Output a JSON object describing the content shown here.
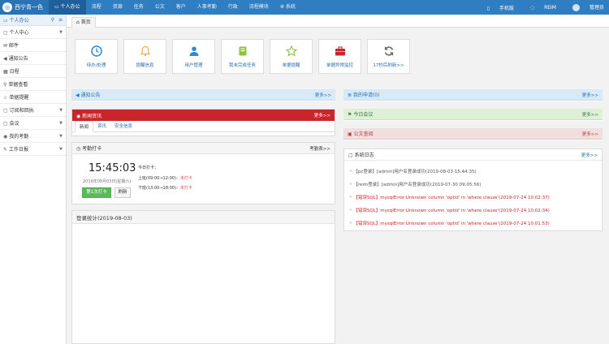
{
  "header": {
    "logo_mark": "◎",
    "logo_text": "西宁青一色",
    "nav": [
      {
        "label": "个人办公",
        "icon": "monitor-icon",
        "glyph": "▭",
        "active": true
      },
      {
        "label": "流程",
        "active": false
      },
      {
        "label": "资源",
        "active": false
      },
      {
        "label": "任务",
        "active": false
      },
      {
        "label": "公文",
        "active": false
      },
      {
        "label": "客户",
        "active": false
      },
      {
        "label": "人事考勤",
        "active": false
      },
      {
        "label": "行政",
        "active": false
      },
      {
        "label": "流程模块",
        "active": false
      },
      {
        "label": "系统",
        "icon": "gear-icon",
        "glyph": "✲",
        "active": false
      }
    ],
    "right": {
      "mobile": "手机版",
      "im": "REIM",
      "user": "管理员"
    }
  },
  "sidebar": {
    "title": "个人办公",
    "items": [
      {
        "label": "个人中心",
        "glyph": "▢",
        "expandable": true
      },
      {
        "label": "邮件",
        "glyph": "✉",
        "expandable": false
      },
      {
        "label": "通知公告",
        "glyph": "◀",
        "expandable": false
      },
      {
        "label": "日程",
        "glyph": "▦",
        "expandable": false
      },
      {
        "label": "单据查看",
        "glyph": "⚲",
        "expandable": false
      },
      {
        "label": "单据提醒",
        "glyph": "☆",
        "expandable": false
      },
      {
        "label": "订阅和回执",
        "glyph": "▢",
        "expandable": true
      },
      {
        "label": "会议",
        "glyph": "▢",
        "expandable": true
      },
      {
        "label": "我的考勤",
        "glyph": "◉",
        "expandable": true
      },
      {
        "label": "工作日报",
        "glyph": "✎",
        "expandable": true
      }
    ]
  },
  "tabbar": {
    "home": "首页"
  },
  "shortcuts": [
    {
      "label": "待办/处理",
      "icon": "clock-icon",
      "color": "#2a8ad8"
    },
    {
      "label": "提醒信息",
      "icon": "bell-icon",
      "color": "#f0ad4e"
    },
    {
      "label": "用户管理",
      "icon": "user-icon",
      "color": "#2a8ad8"
    },
    {
      "label": "我未完成任务",
      "icon": "book-icon",
      "color": "#8dc33f"
    },
    {
      "label": "单据提醒",
      "icon": "star-icon",
      "color": "#8dc33f"
    },
    {
      "label": "单据异常监控",
      "icon": "briefcase-icon",
      "color": "#c9262c"
    },
    {
      "label": "17秒后刷新>>",
      "icon": "refresh-icon",
      "color": "#666666"
    }
  ],
  "panels": {
    "notice": {
      "title": "通知公告",
      "more": "更多>>"
    },
    "news": {
      "title": "新闻资讯",
      "more": "更多>>",
      "tabs": [
        "新闻",
        "资讯",
        "安全信息"
      ]
    },
    "attendance": {
      "title": "考勤打卡",
      "more": "考勤表>>",
      "time": "15:45:03",
      "date": "2019年08月03日(星期六)",
      "today_label": "今日打卡：",
      "am_label": "上班(09:00→12:00)：",
      "am_status": "未打卡",
      "pm_label": "下班(13:00→18:00)：",
      "pm_status": "未打卡",
      "punch_button": "第1次打卡",
      "refresh_button": "刷新"
    },
    "login_stats": {
      "title": "登录统计(2019-08-03)"
    },
    "my_apply": {
      "title": "我的申请(0)",
      "more": "更多>>"
    },
    "meeting": {
      "title": "今日会议",
      "more": "更多>>"
    },
    "document": {
      "title": "公文查阅",
      "more": "更多>>"
    },
    "syslog": {
      "title": "系统日志",
      "more": "更多>>",
      "entries": [
        {
          "text": "【pc登录】[admin]用户名登录成功(2019-08-03 15:44:35)",
          "error": false
        },
        {
          "text": "【reim登录】[admin]用户名登录成功(2019-07-30 09:05:56)",
          "error": false
        },
        {
          "text": "【错误SQL】mysqlError:Unknown column 'optid' in 'where clause'(2019-07-24 10:02:37)",
          "error": true
        },
        {
          "text": "【错误SQL】mysqlError:Unknown column 'optid' in 'where clause'(2019-07-24 10:02:34)",
          "error": true
        },
        {
          "text": "【错误SQL】mysqlError:Unknown column 'optid' in 'where clause'(2019-07-24 10:01:53)",
          "error": true
        }
      ]
    }
  }
}
